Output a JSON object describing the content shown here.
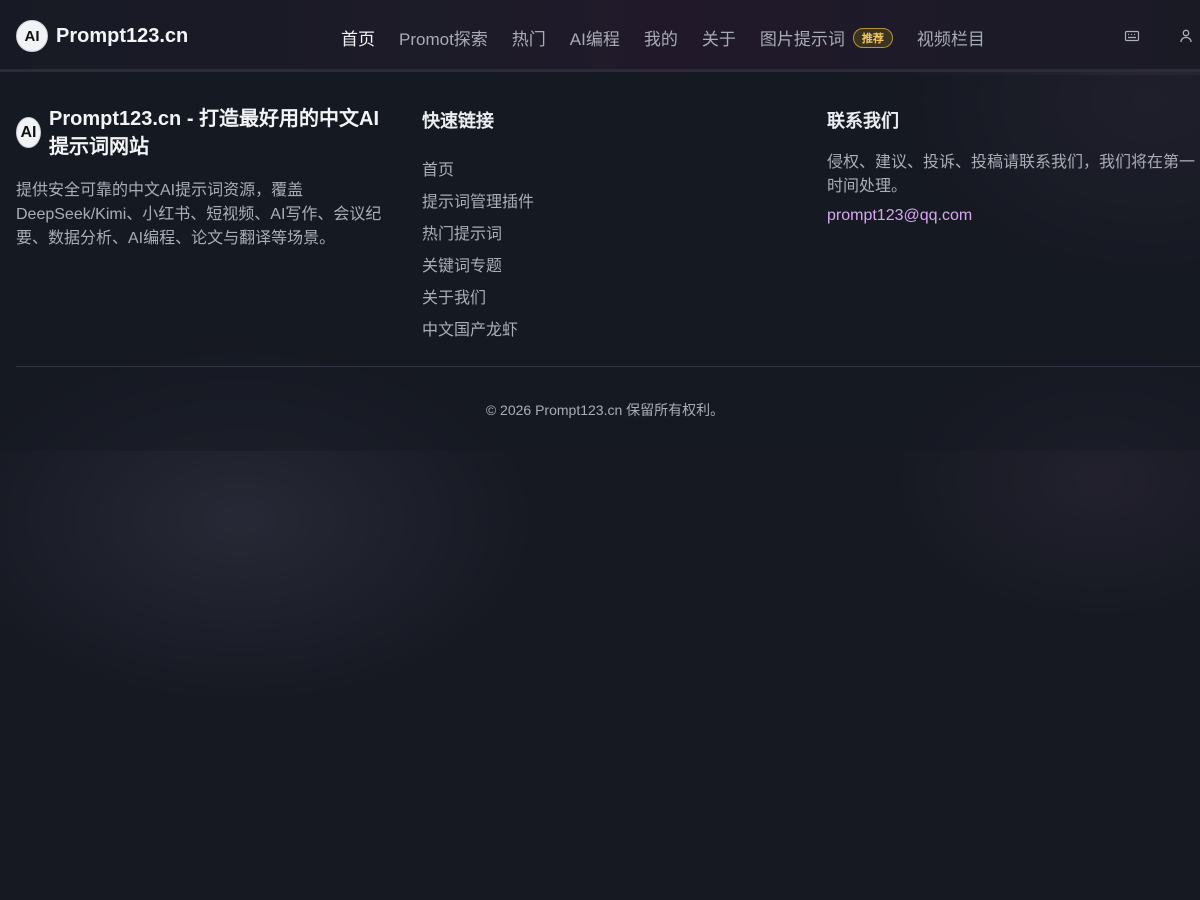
{
  "header": {
    "logo_badge": "AI",
    "logo_text": "Prompt123.cn",
    "nav": [
      {
        "label": "首页"
      },
      {
        "label": "Promot探索"
      },
      {
        "label": "热门"
      },
      {
        "label": "AI编程"
      },
      {
        "label": "我的"
      },
      {
        "label": "关于"
      },
      {
        "label": "图片提示词",
        "badge": "推荐"
      },
      {
        "label": "视频栏目"
      }
    ],
    "icons": [
      "keyboard-icon",
      "user-icon"
    ]
  },
  "footer": {
    "brand_badge": "AI",
    "brand_title": "Prompt123.cn - 打造最好用的中文AI提示词网站",
    "brand_desc": "提供安全可靠的中文AI提示词资源，覆盖DeepSeek/Kimi、小红书、短视频、AI写作、会议纪要、数据分析、AI编程、论文与翻译等场景。",
    "quick_links_title": "快速链接",
    "quick_links": [
      {
        "label": "首页"
      },
      {
        "label": "提示词管理插件"
      },
      {
        "label": "热门提示词"
      },
      {
        "label": "关键词专题"
      },
      {
        "label": "关于我们"
      },
      {
        "label": "中文国产龙虾"
      }
    ],
    "contact_title": "联系我们",
    "contact_desc": "侵权、建议、投诉、投稿请联系我们，我们将在第一时间处理。",
    "contact_email": "prompt123@qq.com",
    "copyright": "© 2026 Prompt123.cn 保留所有权利。"
  },
  "colors": {
    "background": "#161922",
    "accent_link": "#d8a6f0",
    "badge": "#f5c65c"
  }
}
